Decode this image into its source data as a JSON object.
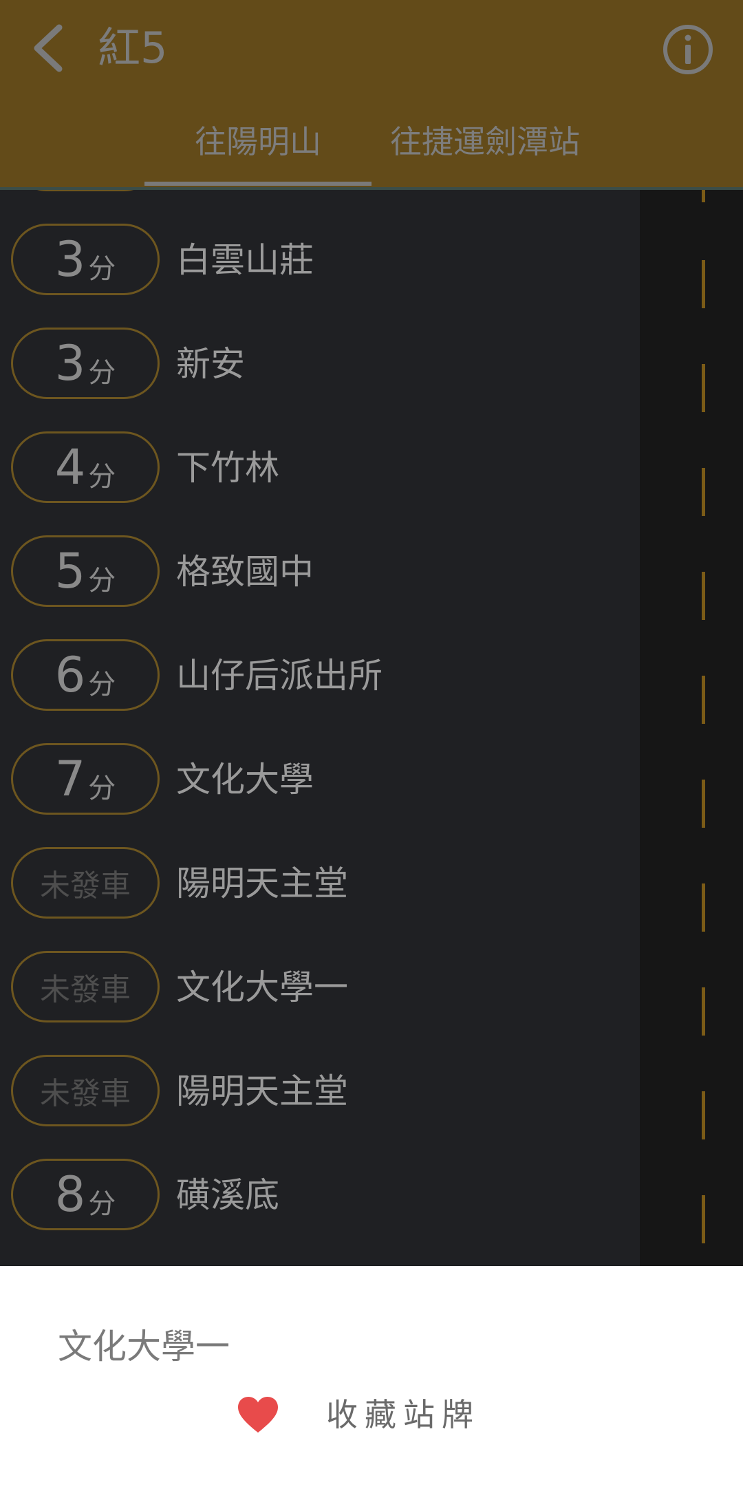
{
  "header": {
    "title": "紅5",
    "back_icon": "chevron-left-icon",
    "info_icon": "info-circle-icon",
    "bg_color": "#634b19",
    "tabs": [
      {
        "label": "往陽明山",
        "selected": true
      },
      {
        "label": "往捷運劍潭站",
        "selected": false
      }
    ]
  },
  "stops": [
    {
      "eta": "3",
      "unit": "分",
      "name": "白雲山莊"
    },
    {
      "eta": "3",
      "unit": "分",
      "name": "新安"
    },
    {
      "eta": "4",
      "unit": "分",
      "name": "下竹林"
    },
    {
      "eta": "5",
      "unit": "分",
      "name": "格致國中"
    },
    {
      "eta": "6",
      "unit": "分",
      "name": "山仔后派出所"
    },
    {
      "eta": "7",
      "unit": "分",
      "name": "文化大學"
    },
    {
      "status": "未發車",
      "name": "陽明天主堂"
    },
    {
      "status": "未發車",
      "name": "文化大學一"
    },
    {
      "status": "未發車",
      "name": "陽明天主堂"
    },
    {
      "eta": "8",
      "unit": "分",
      "name": "磺溪底"
    }
  ],
  "sheet": {
    "stop_name": "文化大學一",
    "favorite_label": "收藏站牌",
    "favorite_icon": "heart-icon",
    "heart_color": "#e84b4b"
  }
}
